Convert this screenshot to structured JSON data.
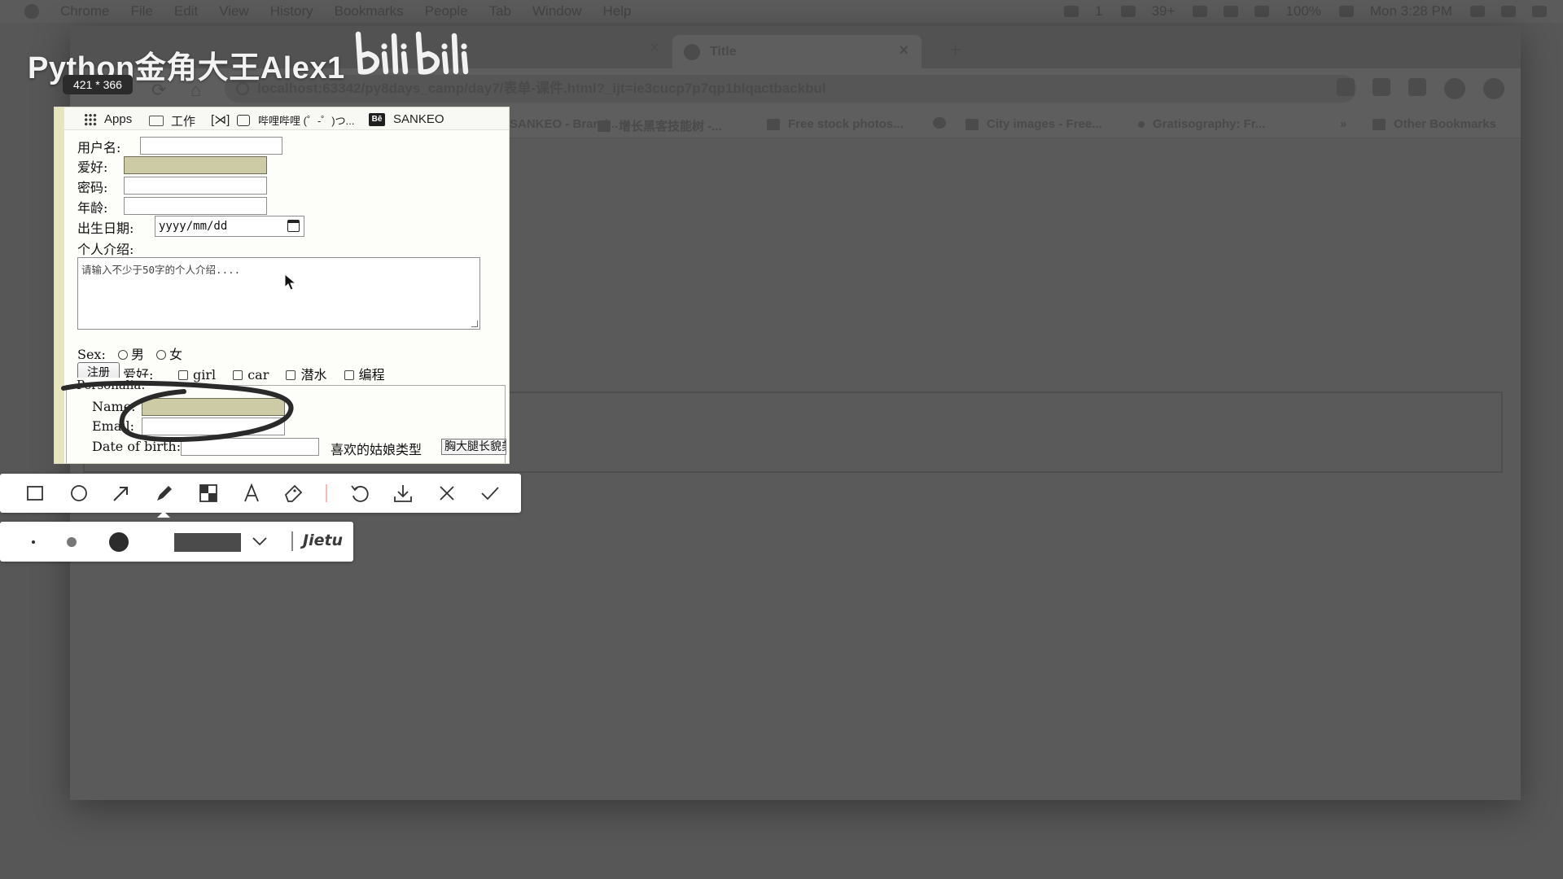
{
  "menubar": {
    "items": [
      "Chrome",
      "File",
      "Edit",
      "View",
      "History",
      "Bookmarks",
      "People",
      "Tab",
      "Window",
      "Help"
    ],
    "status": {
      "count": "1",
      "temp": "39+",
      "battery": "100%",
      "clock": "Mon 3:28 PM"
    }
  },
  "watermark": {
    "title": "Python金角大王Alex1",
    "logo_text": "bilibili"
  },
  "capture_size": "421 * 366",
  "browser": {
    "tab_title": "Title",
    "url": "localhost:63342/py8days_camp/day7/表单-课件.html?_ijt=ie3cucp7p7qp1blqactbackbul",
    "bookmarks": [
      "Apps",
      "工作",
      "哔哩哔哩 (゜-゜)つ...",
      "SANKEO - Brand...",
      "增长黑客技能树 -...",
      "Free stock photos...",
      "City images - Free...",
      "Gratisography: Fr...",
      "Other Bookmarks"
    ],
    "bookmarks_overflow": "»"
  },
  "capture_bookmarks": [
    "Apps",
    "工作",
    "哔哩哔哩 (゜-゜)つ...",
    "SANKEO"
  ],
  "form": {
    "username_label": "用户名:",
    "hobby_label": "爱好:",
    "password_label": "密码:",
    "age_label": "年龄:",
    "birth_label": "出生日期:",
    "birth_placeholder": "yyyy/mm/dd",
    "intro_label": "个人介绍:",
    "intro_placeholder": "请输入不少于50字的个人介绍....",
    "sex_label": "Sex:",
    "sex_options": [
      "男",
      "女"
    ],
    "register_button": "注册",
    "hobbies_label": "爱好:",
    "hobby_options": [
      "girl",
      "car",
      "潜水",
      "编程"
    ],
    "fieldset_legend": "Personalia:",
    "name_label": "Name:",
    "email_label": "Email:",
    "dob_label": "Date of birth:",
    "girl_type_label": "喜欢的姑娘类型",
    "girl_type_value": "胸大腿长貌美"
  },
  "annotation_tool": {
    "tools": [
      "rectangle-icon",
      "ellipse-icon",
      "arrow-icon",
      "pen-icon",
      "mosaic-icon",
      "text-icon",
      "eraser-icon",
      "undo-icon",
      "download-icon",
      "cancel-icon",
      "confirm-icon"
    ],
    "active_tool": "pen-icon",
    "brush_sizes": [
      "small",
      "medium",
      "large"
    ],
    "selected_brush": "large",
    "color": "#4b4b4b",
    "brand": "Jietu",
    "accent_color": "#ffb7b7"
  },
  "colors": {
    "highlight_field": "#cccba6",
    "dim_overlay": "#575757",
    "annotation_stroke": "#2a2a2a"
  }
}
